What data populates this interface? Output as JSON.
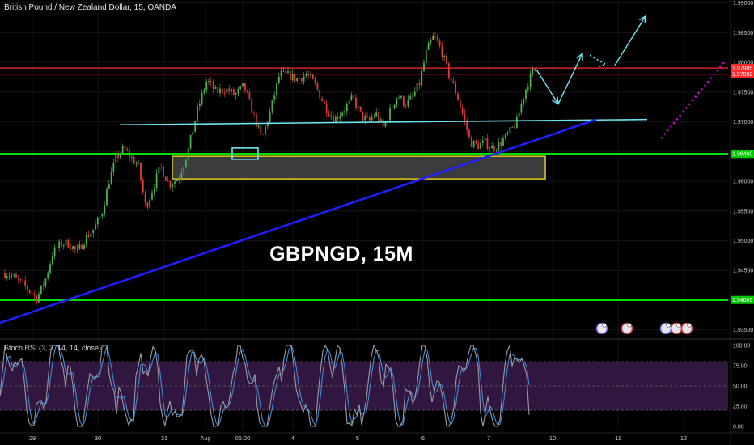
{
  "header": {
    "symbol_title": "British Pound / New Zealand Dollar, 15, OANDA"
  },
  "watermark_label": "GBPNGD, 15M",
  "indicator_label": "Stoch RSI (3, 3, 14, 14, close)",
  "colors": {
    "background": "#000000",
    "candle_up": "#4caf50",
    "candle_down": "#e53935",
    "resistance": "#ff2b2b",
    "support": "#00e000",
    "neckline": "#6fe6ef",
    "trendline": "#1f1fff",
    "zone_border": "#d6c21e",
    "projection": "#6fe6ef",
    "dotted_projection": "#e000e0",
    "stoch_band": "#3a1a4a",
    "stoch_k": "#9a9aa0",
    "stoch_d": "#3a8ad9"
  },
  "chart_data": [
    {
      "type": "candlestick",
      "instrument": "GBP/NZD",
      "timeframe": "15",
      "source": "OANDA",
      "ylim": [
        1.934,
        1.9905
      ],
      "y_ticks": [
        "1.99000",
        "1.98500",
        "1.98000",
        "1.97500",
        "1.97000",
        "1.96500",
        "1.96000",
        "1.95500",
        "1.95000",
        "1.94500",
        "1.94000",
        "1.93500"
      ],
      "x_ticks": [
        "29",
        "30",
        "31",
        "Aug",
        "06:00",
        "4",
        "5",
        "6",
        "7",
        "10",
        "11",
        "12"
      ],
      "price_tags": [
        {
          "label": "1.97905",
          "value": 1.97905,
          "color": "#ff2b2b"
        },
        {
          "label": "1.97802",
          "value": 1.97802,
          "color": "#ff2b2b"
        },
        {
          "label": "1.96460",
          "value": 1.9646,
          "color": "#00c800"
        },
        {
          "label": "1.94003",
          "value": 1.94003,
          "color": "#00c800"
        }
      ],
      "levels": [
        {
          "kind": "resistance",
          "value": 1.97905
        },
        {
          "kind": "resistance",
          "value": 1.97802
        },
        {
          "kind": "support",
          "value": 1.9646
        },
        {
          "kind": "support",
          "value": 1.94003
        },
        {
          "kind": "neckline",
          "from": {
            "date": "Jul 30",
            "value": 1.9695
          },
          "to": {
            "date": "Aug 11",
            "value": 1.9704
          }
        },
        {
          "kind": "trendline",
          "from": {
            "date": "Jul 29",
            "value": 1.9378
          },
          "to": {
            "date": "Aug 10",
            "value": 1.9704
          }
        }
      ],
      "zone": {
        "from": "Jul 31",
        "to": "Aug 6",
        "low": 1.9604,
        "high": 1.9642
      },
      "path": [
        [
          "Jul 28",
          1.9445
        ],
        [
          "Jul 28",
          1.9425
        ],
        [
          "Jul 29",
          1.9403
        ],
        [
          "Jul 29",
          1.943
        ],
        [
          "Jul 29",
          1.948
        ],
        [
          "Jul 29",
          1.9495
        ],
        [
          "Jul 29",
          1.9495
        ],
        [
          "Jul 29",
          1.948
        ],
        [
          "Jul 29",
          1.9505
        ],
        [
          "Jul 29",
          1.952
        ],
        [
          "Jul 30",
          1.9545
        ],
        [
          "Jul 30",
          1.96
        ],
        [
          "Jul 30",
          1.964
        ],
        [
          "Jul 30",
          1.9655
        ],
        [
          "Jul 30",
          1.964
        ],
        [
          "Jul 30",
          1.9625
        ],
        [
          "Jul 30",
          1.9555
        ],
        [
          "Jul 30",
          1.959
        ],
        [
          "Jul 30",
          1.9625
        ],
        [
          "Jul 31",
          1.9595
        ],
        [
          "Jul 31",
          1.9605
        ],
        [
          "Jul 31",
          1.965
        ],
        [
          "Jul 31",
          1.972
        ],
        [
          "Jul 31",
          1.977
        ],
        [
          "Jul 31",
          1.975
        ],
        [
          "Jul 31",
          1.9755
        ],
        [
          "Aug 3",
          1.9745
        ],
        [
          "Aug 3",
          1.976
        ],
        [
          "Aug 3",
          1.9715
        ],
        [
          "Aug 3",
          1.967
        ],
        [
          "Aug 3",
          1.972
        ],
        [
          "Aug 3",
          1.978
        ],
        [
          "Aug 3",
          1.9778
        ],
        [
          "Aug 4",
          1.9772
        ],
        [
          "Aug 4",
          1.978
        ],
        [
          "Aug 4",
          1.976
        ],
        [
          "Aug 4",
          1.9725
        ],
        [
          "Aug 4",
          1.9705
        ],
        [
          "Aug 4",
          1.972
        ],
        [
          "Aug 4",
          1.974
        ],
        [
          "Aug 5",
          1.971
        ],
        [
          "Aug 5",
          1.97
        ],
        [
          "Aug 5",
          1.9715
        ],
        [
          "Aug 5",
          1.969
        ],
        [
          "Aug 5",
          1.972
        ],
        [
          "Aug 5",
          1.9745
        ],
        [
          "Aug 5",
          1.973
        ],
        [
          "Aug 5",
          1.974
        ],
        [
          "Aug 5",
          1.9765
        ],
        [
          "Aug 6",
          1.982
        ],
        [
          "Aug 6",
          1.9845
        ],
        [
          "Aug 6",
          1.982
        ],
        [
          "Aug 6",
          1.978
        ],
        [
          "Aug 6",
          1.975
        ],
        [
          "Aug 6",
          1.971
        ],
        [
          "Aug 6",
          1.9665
        ],
        [
          "Aug 6",
          1.966
        ],
        [
          "Aug 6",
          1.9665
        ],
        [
          "Aug 7",
          1.9655
        ],
        [
          "Aug 7",
          1.9665
        ],
        [
          "Aug 7",
          1.968
        ],
        [
          "Aug 7",
          1.97
        ],
        [
          "Aug 7",
          1.975
        ],
        [
          "Aug 7",
          1.9785
        ],
        [
          "Aug 7",
          1.9788
        ],
        [
          "Aug 7",
          1.9784
        ]
      ],
      "projection_arrows": [
        [
          {
            "date": "Aug 7",
            "value": 1.9788
          },
          {
            "date": "Aug 10",
            "value": 1.973
          }
        ],
        [
          {
            "date": "Aug 10",
            "value": 1.973
          },
          {
            "date": "Aug 10",
            "value": 1.9815
          }
        ],
        [
          {
            "date": "Aug 11",
            "value": 1.9795
          },
          {
            "date": "Aug 11",
            "value": 1.9878
          }
        ]
      ],
      "dotted_projection": [
        {
          "date": "Aug 11",
          "value": 1.9672
        },
        {
          "date": "Aug 12",
          "value": 1.98
        }
      ]
    },
    {
      "type": "line",
      "title": "Stoch RSI (3, 3, 14, 14, close)",
      "ylim": [
        -5,
        105
      ],
      "y_ticks": [
        "100.00",
        "75.00",
        "50.00",
        "25.00",
        "0.00"
      ],
      "band": [
        20,
        80
      ]
    }
  ]
}
